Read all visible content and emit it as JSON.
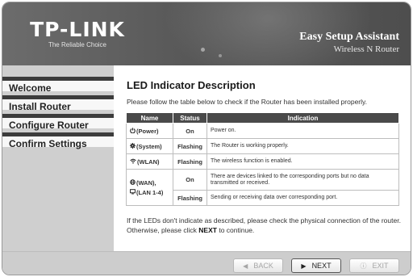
{
  "header": {
    "logo": "TP-LINK",
    "tagline": "The Reliable Choice",
    "assistant_title": "Easy Setup Assistant",
    "assistant_subtitle": "Wireless N Router"
  },
  "sidebar": {
    "items": [
      {
        "label": "Welcome"
      },
      {
        "label": "Install Router"
      },
      {
        "label": "Configure Router"
      },
      {
        "label": "Confirm Settings"
      }
    ]
  },
  "main": {
    "title": "LED Indicator Description",
    "intro": "Please follow the table below to check if the Router has been installed properly.",
    "table": {
      "headers": [
        "Name",
        "Status",
        "Indication"
      ],
      "rows": [
        {
          "name": "(Power)",
          "status": "On",
          "indication": "Power on."
        },
        {
          "name": "(System)",
          "status": "Flashing",
          "indication": "The Router is working properly."
        },
        {
          "name": "(WLAN)",
          "status": "Flashing",
          "indication": "The wireless function is enabled."
        },
        {
          "name_line1": "(WAN),",
          "name_line2": "(LAN 1-4)",
          "status": "On",
          "indication": "There are devices linked to the corresponding ports but no data transmitted or received."
        },
        {
          "status": "Flashing",
          "indication": "Sending or receiving data over corresponding port."
        }
      ]
    },
    "footer_pre": "If the LEDs don't indicate as described, please check the physical connection of the router. Otherwise, please click ",
    "footer_bold": "NEXT",
    "footer_post": " to continue."
  },
  "buttons": {
    "back": "BACK",
    "next": "NEXT",
    "exit": "EXIT"
  },
  "icons": {
    "power": "power-icon",
    "system": "gear-icon",
    "wlan": "wireless-icon",
    "wan": "globe-icon",
    "lan": "monitor-icon"
  }
}
